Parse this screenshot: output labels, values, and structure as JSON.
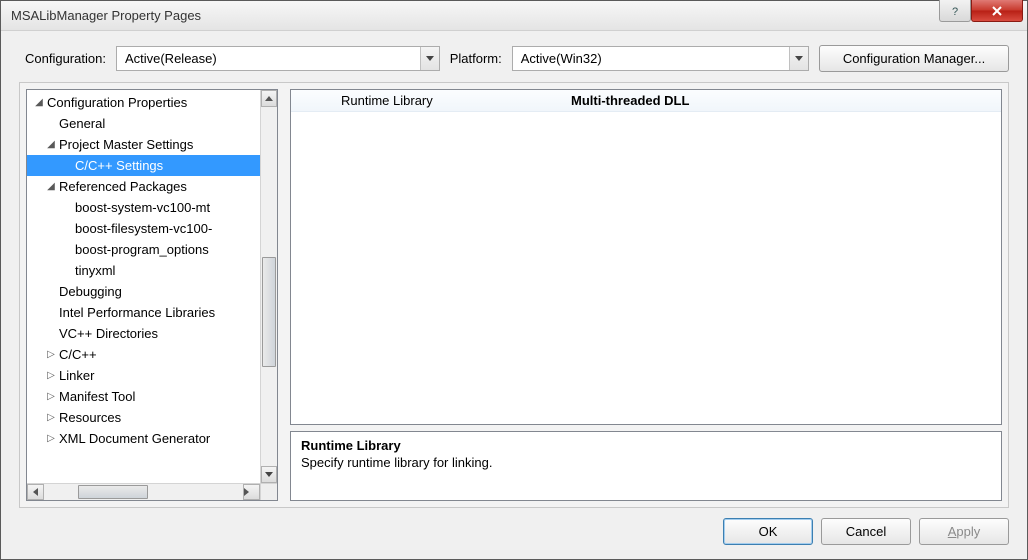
{
  "window": {
    "title": "MSALibManager Property Pages"
  },
  "top": {
    "config_label": "Configuration:",
    "config_value": "Active(Release)",
    "platform_label": "Platform:",
    "platform_value": "Active(Win32)",
    "cfgmgr_label": "Configuration Manager..."
  },
  "tree": {
    "root": "Configuration Properties",
    "general": "General",
    "pms": "Project Master Settings",
    "cpp_settings": "C/C++ Settings",
    "refpkg": "Referenced Packages",
    "pkgs": {
      "boost_system": "boost-system-vc100-mt",
      "boost_fs": "boost-filesystem-vc100-",
      "boost_po": "boost-program_options",
      "tinyxml": "tinyxml"
    },
    "debugging": "Debugging",
    "intel": "Intel Performance Libraries",
    "vcdirs": "VC++ Directories",
    "cpp": "C/C++",
    "linker": "Linker",
    "manifest": "Manifest Tool",
    "resources": "Resources",
    "xmlgen": "XML Document Generator"
  },
  "property": {
    "name": "Runtime Library",
    "value": "Multi-threaded DLL"
  },
  "desc": {
    "heading": "Runtime Library",
    "text": "Specify runtime library for linking."
  },
  "buttons": {
    "ok": "OK",
    "cancel": "Cancel",
    "apply": "Apply"
  }
}
